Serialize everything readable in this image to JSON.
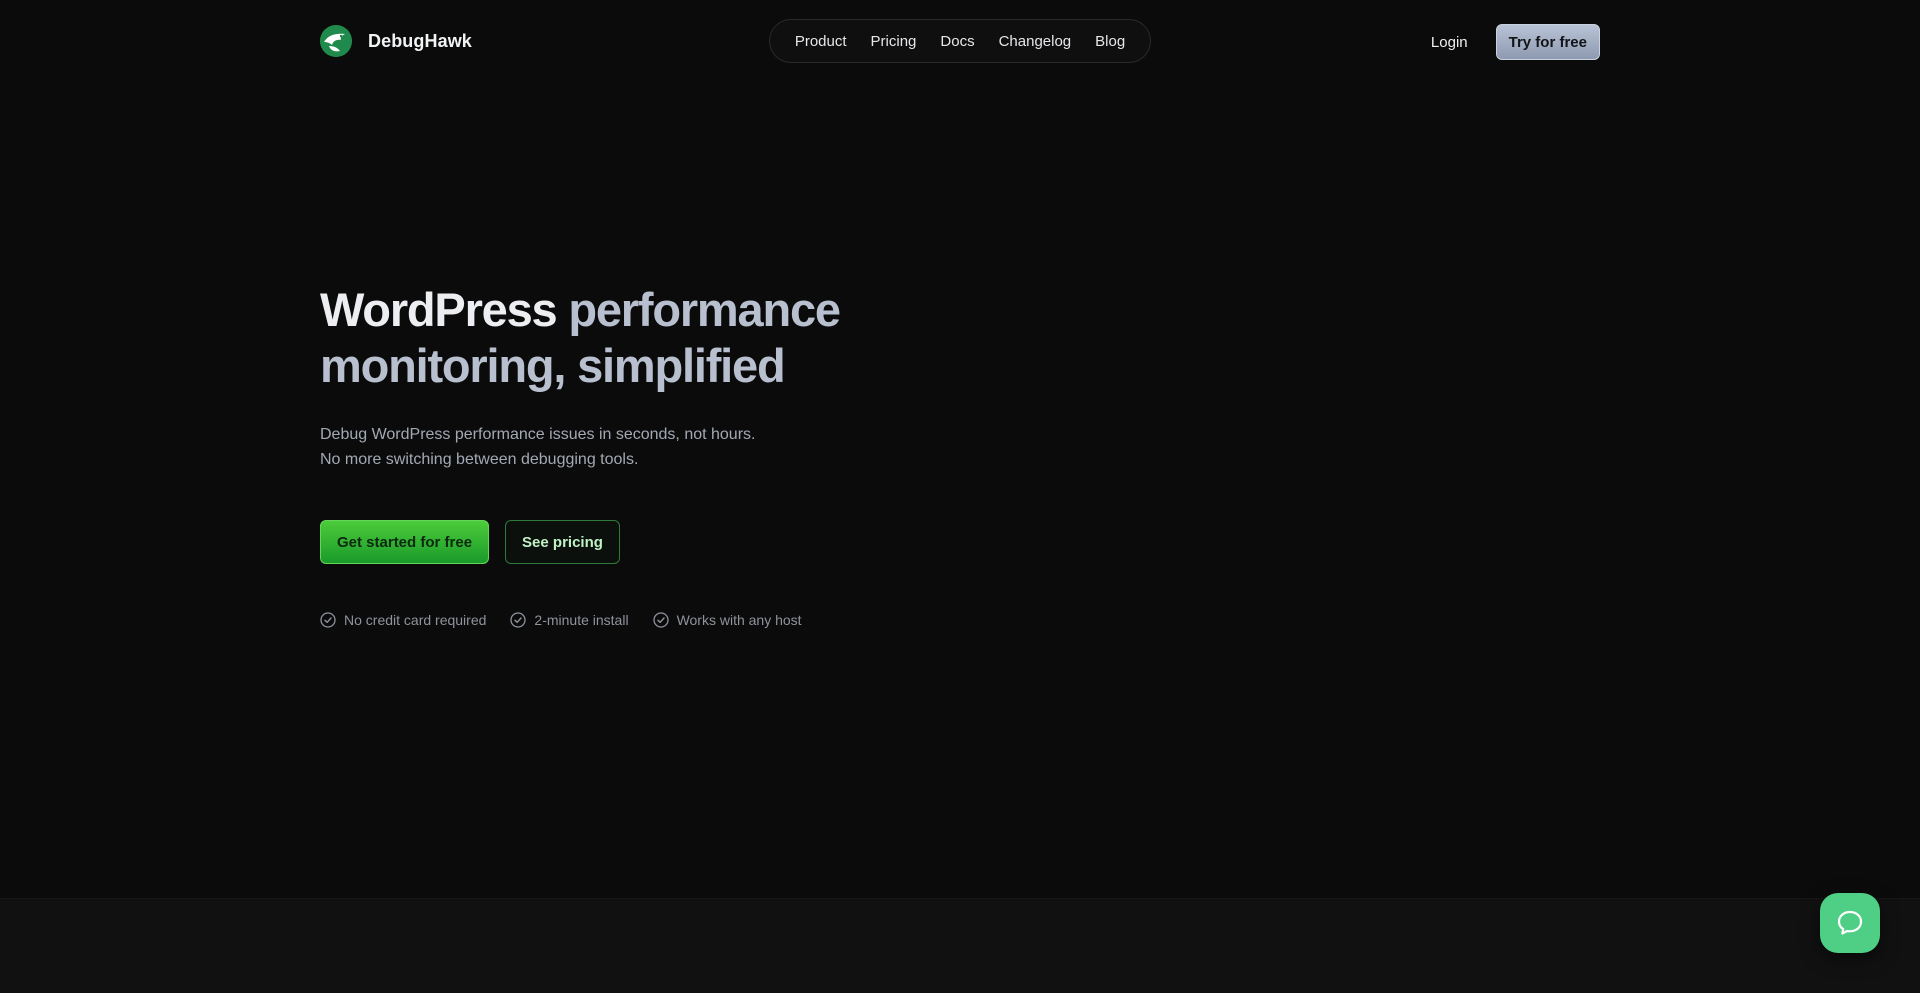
{
  "brand": {
    "name": "DebugHawk",
    "logo_icon": "hawk-icon"
  },
  "nav": {
    "items": [
      {
        "label": "Product"
      },
      {
        "label": "Pricing"
      },
      {
        "label": "Docs"
      },
      {
        "label": "Changelog"
      },
      {
        "label": "Blog"
      }
    ]
  },
  "header": {
    "login_label": "Login",
    "try_label": "Try for free"
  },
  "hero": {
    "headline_line1_strong": "WordPress",
    "headline_line1_soft": " performance",
    "headline_line2": "monitoring, simplified",
    "subtitle_line1": "Debug WordPress performance issues in seconds, not hours.",
    "subtitle_line2": "No more switching between debugging tools.",
    "cta_primary": "Get started for free",
    "cta_secondary": "See pricing",
    "features": [
      {
        "label": "No credit card required",
        "icon": "check-circle-icon"
      },
      {
        "label": "2-minute install",
        "icon": "check-circle-icon"
      },
      {
        "label": "Works with any host",
        "icon": "check-circle-icon"
      }
    ]
  },
  "chat": {
    "icon": "chat-bubble-icon"
  },
  "colors": {
    "background": "#0b0b0b",
    "accent_green": "#2fb23a",
    "chat_green": "#4fcf85",
    "try_button": "#a6b1c6"
  }
}
